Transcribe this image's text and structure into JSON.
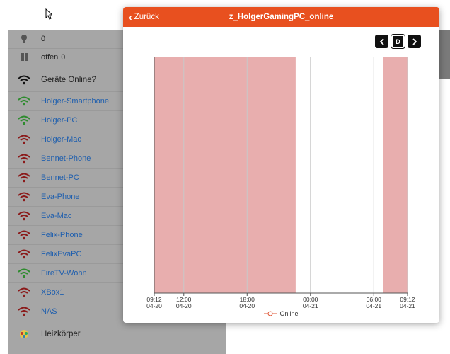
{
  "background": {
    "rows": [
      {
        "label": "0",
        "kind": "plain",
        "icon": "lightbulb-icon",
        "wifi_color": ""
      },
      {
        "label": "offen",
        "count": "0",
        "kind": "plain",
        "icon": "windows-icon",
        "wifi_color": ""
      },
      {
        "label": "Geräte Online?",
        "kind": "head",
        "icon": "wifi-icon",
        "wifi_color": "#111111"
      },
      {
        "label": "Holger-Smartphone",
        "kind": "device",
        "icon": "wifi-icon",
        "wifi_color": "#2e8b2e"
      },
      {
        "label": "Holger-PC",
        "kind": "device",
        "icon": "wifi-icon",
        "wifi_color": "#2e8b2e"
      },
      {
        "label": "Holger-Mac",
        "kind": "device",
        "icon": "wifi-icon",
        "wifi_color": "#8b1a1a"
      },
      {
        "label": "Bennet-Phone",
        "kind": "device",
        "icon": "wifi-icon",
        "wifi_color": "#8b1a1a"
      },
      {
        "label": "Bennet-PC",
        "kind": "device",
        "icon": "wifi-icon",
        "wifi_color": "#8b1a1a"
      },
      {
        "label": "Eva-Phone",
        "kind": "device",
        "icon": "wifi-icon",
        "wifi_color": "#8b1a1a"
      },
      {
        "label": "Eva-Mac",
        "kind": "device",
        "icon": "wifi-icon",
        "wifi_color": "#8b1a1a"
      },
      {
        "label": "Felix-Phone",
        "kind": "device",
        "icon": "wifi-icon",
        "wifi_color": "#8b1a1a"
      },
      {
        "label": "FelixEvaPC",
        "kind": "device",
        "icon": "wifi-icon",
        "wifi_color": "#8b1a1a"
      },
      {
        "label": "FireTV-Wohn",
        "kind": "device",
        "icon": "wifi-icon",
        "wifi_color": "#2e8b2e"
      },
      {
        "label": "XBox1",
        "kind": "device",
        "icon": "wifi-icon",
        "wifi_color": "#8b1a1a"
      },
      {
        "label": "NAS",
        "kind": "device",
        "icon": "wifi-icon",
        "wifi_color": "#8b1a1a"
      },
      {
        "label": "Heizkörper",
        "kind": "head",
        "icon": "heater-icon",
        "wifi_color": ""
      }
    ]
  },
  "modal": {
    "back_label": "Zurück",
    "title": "z_HolgerGamingPC_online",
    "accent": "#e8501f",
    "nav": {
      "prev_icon": "chevron-left-icon",
      "period_label": "D",
      "next_icon": "chevron-right-icon"
    }
  },
  "chart_data": {
    "type": "area",
    "series": [
      {
        "name": "Online",
        "color": "#e8aeae",
        "stroke": "#e05a3a"
      }
    ],
    "x_ticks": [
      {
        "time": "09:12",
        "date": "04-20",
        "hour": 0
      },
      {
        "time": "12:00",
        "date": "04-20",
        "hour": 2.8
      },
      {
        "time": "18:00",
        "date": "04-20",
        "hour": 8.8
      },
      {
        "time": "00:00",
        "date": "04-21",
        "hour": 14.8
      },
      {
        "time": "06:00",
        "date": "04-21",
        "hour": 20.8
      },
      {
        "time": "09:12",
        "date": "04-21",
        "hour": 24
      }
    ],
    "online_intervals": [
      {
        "start": 0,
        "end": 13.4
      },
      {
        "start": 21.7,
        "end": 24
      }
    ],
    "xlim": [
      0,
      24
    ],
    "ylim": [
      0,
      1
    ],
    "grid": true,
    "legend": "bottom-center"
  }
}
